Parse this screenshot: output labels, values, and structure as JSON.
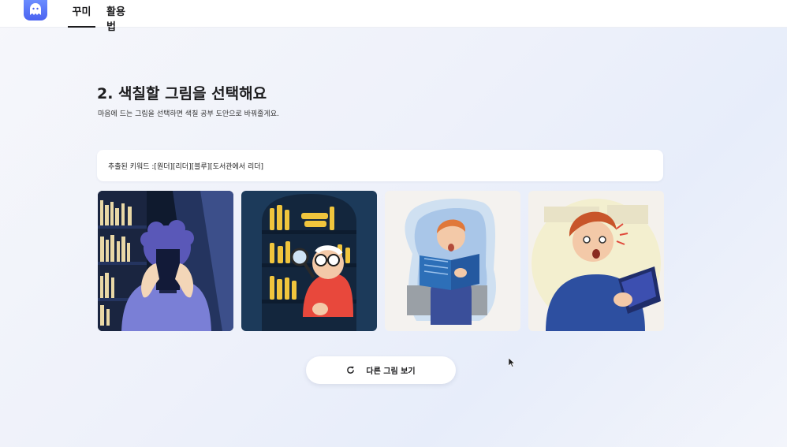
{
  "nav": {
    "tabs": [
      {
        "label": "꾸미",
        "active": true
      },
      {
        "label": "활용법",
        "active": false
      }
    ]
  },
  "main": {
    "title": "2. 색칠할 그림을 선택해요",
    "subtitle": "마음에 드는 그림을 선택하면 색칠 공부 도안으로 바꿔줄게요.",
    "keywords_text": "추출된 키워드 :[원더][리더][블루][도서관에서 리더]",
    "images": [
      {
        "subject": "woman reading book in library"
      },
      {
        "subject": "man with magnifying glass at bookshelf"
      },
      {
        "subject": "boy reading book"
      },
      {
        "subject": "surprised man holding book"
      }
    ],
    "reload_label": "다른 그림 보기"
  },
  "colors": {
    "accent": "#4b63f0",
    "book_blue": "#2d4a9a",
    "shelf_navy": "#1c3a5a"
  }
}
